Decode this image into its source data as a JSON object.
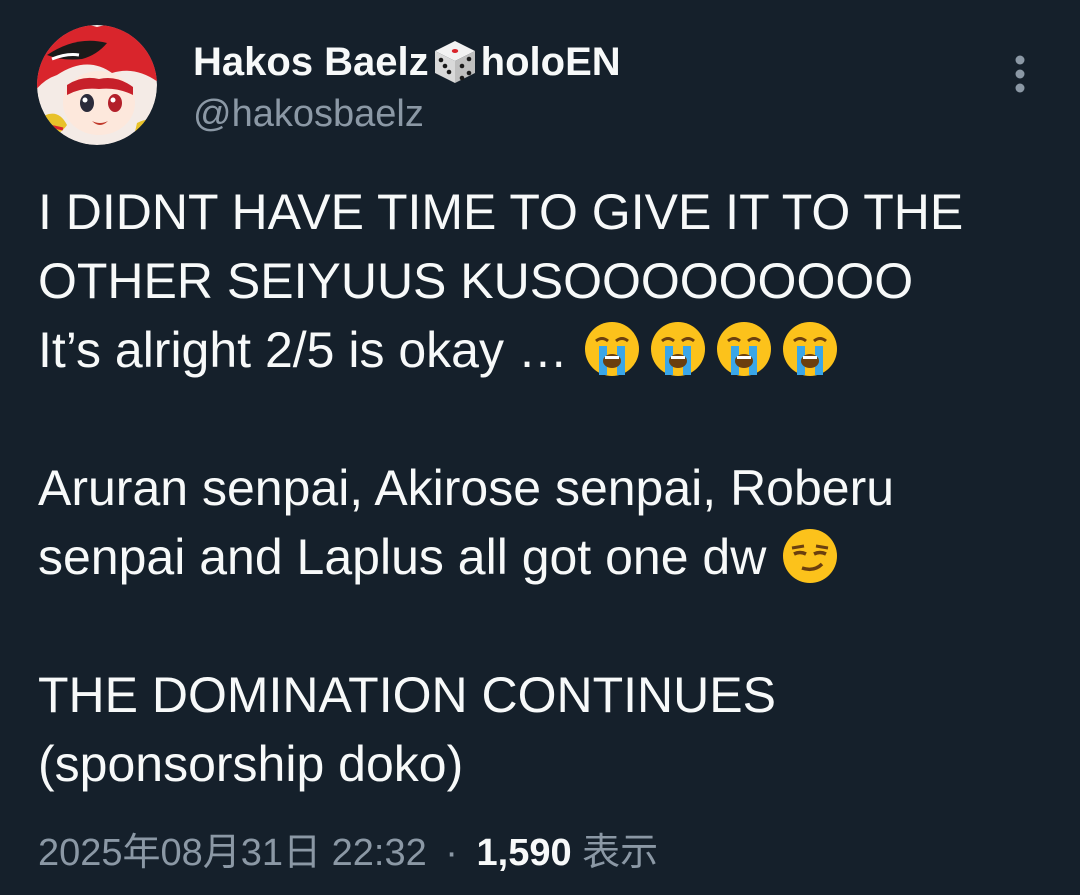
{
  "user": {
    "display_name_prefix": "Hakos Baelz",
    "display_name_icon": "dice-icon",
    "display_name_suffix": "holoEN",
    "handle": "@hakosbaelz",
    "avatar_icon": "avatar-image"
  },
  "menu": {
    "icon": "more-vertical-icon"
  },
  "tweet": {
    "lines": [
      "I DIDNT HAVE TIME TO GIVE IT TO THE",
      "OTHER SEIYUUS KUSOOOOOOOOO",
      "It’s alright 2/5 is okay …",
      "Aruran senpai, Akirose senpai, Roberu",
      "senpai and Laplus all got one dw",
      "THE DOMINATION CONTINUES",
      "(sponsorship doko)"
    ],
    "emojis": {
      "line3": [
        "loudly-crying-face",
        "loudly-crying-face",
        "loudly-crying-face",
        "loudly-crying-face"
      ],
      "line5": [
        "smirking-face"
      ]
    }
  },
  "meta": {
    "timestamp": "2025年08月31日 22:32",
    "separator": "·",
    "views_count": "1,590",
    "views_label": "表示"
  },
  "colors": {
    "background": "#15202b",
    "text_primary": "#f7f9f9",
    "text_secondary": "#8b98a5"
  }
}
